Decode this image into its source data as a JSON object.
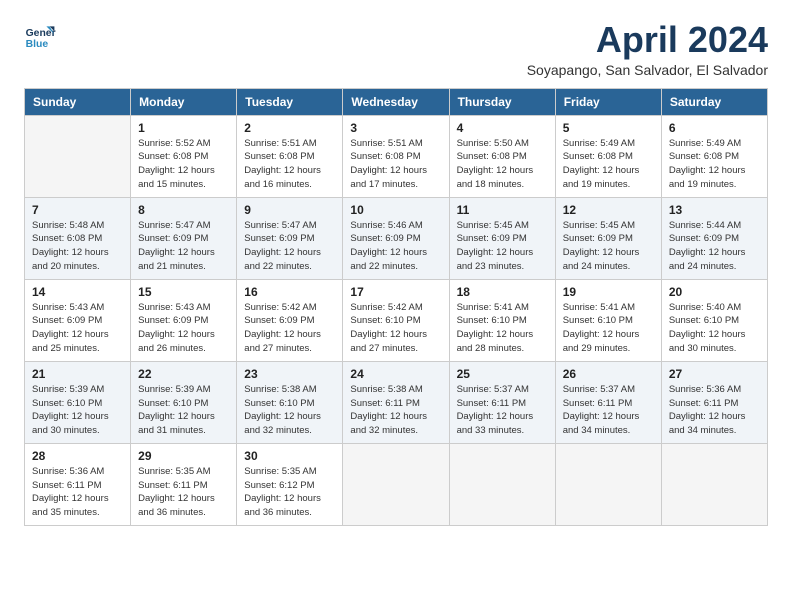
{
  "logo": {
    "line1": "General",
    "line2": "Blue"
  },
  "title": "April 2024",
  "subtitle": "Soyapango, San Salvador, El Salvador",
  "days_header": [
    "Sunday",
    "Monday",
    "Tuesday",
    "Wednesday",
    "Thursday",
    "Friday",
    "Saturday"
  ],
  "weeks": [
    [
      {
        "day": "",
        "info": ""
      },
      {
        "day": "1",
        "info": "Sunrise: 5:52 AM\nSunset: 6:08 PM\nDaylight: 12 hours\nand 15 minutes."
      },
      {
        "day": "2",
        "info": "Sunrise: 5:51 AM\nSunset: 6:08 PM\nDaylight: 12 hours\nand 16 minutes."
      },
      {
        "day": "3",
        "info": "Sunrise: 5:51 AM\nSunset: 6:08 PM\nDaylight: 12 hours\nand 17 minutes."
      },
      {
        "day": "4",
        "info": "Sunrise: 5:50 AM\nSunset: 6:08 PM\nDaylight: 12 hours\nand 18 minutes."
      },
      {
        "day": "5",
        "info": "Sunrise: 5:49 AM\nSunset: 6:08 PM\nDaylight: 12 hours\nand 19 minutes."
      },
      {
        "day": "6",
        "info": "Sunrise: 5:49 AM\nSunset: 6:08 PM\nDaylight: 12 hours\nand 19 minutes."
      }
    ],
    [
      {
        "day": "7",
        "info": "Sunrise: 5:48 AM\nSunset: 6:08 PM\nDaylight: 12 hours\nand 20 minutes."
      },
      {
        "day": "8",
        "info": "Sunrise: 5:47 AM\nSunset: 6:09 PM\nDaylight: 12 hours\nand 21 minutes."
      },
      {
        "day": "9",
        "info": "Sunrise: 5:47 AM\nSunset: 6:09 PM\nDaylight: 12 hours\nand 22 minutes."
      },
      {
        "day": "10",
        "info": "Sunrise: 5:46 AM\nSunset: 6:09 PM\nDaylight: 12 hours\nand 22 minutes."
      },
      {
        "day": "11",
        "info": "Sunrise: 5:45 AM\nSunset: 6:09 PM\nDaylight: 12 hours\nand 23 minutes."
      },
      {
        "day": "12",
        "info": "Sunrise: 5:45 AM\nSunset: 6:09 PM\nDaylight: 12 hours\nand 24 minutes."
      },
      {
        "day": "13",
        "info": "Sunrise: 5:44 AM\nSunset: 6:09 PM\nDaylight: 12 hours\nand 24 minutes."
      }
    ],
    [
      {
        "day": "14",
        "info": "Sunrise: 5:43 AM\nSunset: 6:09 PM\nDaylight: 12 hours\nand 25 minutes."
      },
      {
        "day": "15",
        "info": "Sunrise: 5:43 AM\nSunset: 6:09 PM\nDaylight: 12 hours\nand 26 minutes."
      },
      {
        "day": "16",
        "info": "Sunrise: 5:42 AM\nSunset: 6:09 PM\nDaylight: 12 hours\nand 27 minutes."
      },
      {
        "day": "17",
        "info": "Sunrise: 5:42 AM\nSunset: 6:10 PM\nDaylight: 12 hours\nand 27 minutes."
      },
      {
        "day": "18",
        "info": "Sunrise: 5:41 AM\nSunset: 6:10 PM\nDaylight: 12 hours\nand 28 minutes."
      },
      {
        "day": "19",
        "info": "Sunrise: 5:41 AM\nSunset: 6:10 PM\nDaylight: 12 hours\nand 29 minutes."
      },
      {
        "day": "20",
        "info": "Sunrise: 5:40 AM\nSunset: 6:10 PM\nDaylight: 12 hours\nand 30 minutes."
      }
    ],
    [
      {
        "day": "21",
        "info": "Sunrise: 5:39 AM\nSunset: 6:10 PM\nDaylight: 12 hours\nand 30 minutes."
      },
      {
        "day": "22",
        "info": "Sunrise: 5:39 AM\nSunset: 6:10 PM\nDaylight: 12 hours\nand 31 minutes."
      },
      {
        "day": "23",
        "info": "Sunrise: 5:38 AM\nSunset: 6:10 PM\nDaylight: 12 hours\nand 32 minutes."
      },
      {
        "day": "24",
        "info": "Sunrise: 5:38 AM\nSunset: 6:11 PM\nDaylight: 12 hours\nand 32 minutes."
      },
      {
        "day": "25",
        "info": "Sunrise: 5:37 AM\nSunset: 6:11 PM\nDaylight: 12 hours\nand 33 minutes."
      },
      {
        "day": "26",
        "info": "Sunrise: 5:37 AM\nSunset: 6:11 PM\nDaylight: 12 hours\nand 34 minutes."
      },
      {
        "day": "27",
        "info": "Sunrise: 5:36 AM\nSunset: 6:11 PM\nDaylight: 12 hours\nand 34 minutes."
      }
    ],
    [
      {
        "day": "28",
        "info": "Sunrise: 5:36 AM\nSunset: 6:11 PM\nDaylight: 12 hours\nand 35 minutes."
      },
      {
        "day": "29",
        "info": "Sunrise: 5:35 AM\nSunset: 6:11 PM\nDaylight: 12 hours\nand 36 minutes."
      },
      {
        "day": "30",
        "info": "Sunrise: 5:35 AM\nSunset: 6:12 PM\nDaylight: 12 hours\nand 36 minutes."
      },
      {
        "day": "",
        "info": ""
      },
      {
        "day": "",
        "info": ""
      },
      {
        "day": "",
        "info": ""
      },
      {
        "day": "",
        "info": ""
      }
    ]
  ]
}
